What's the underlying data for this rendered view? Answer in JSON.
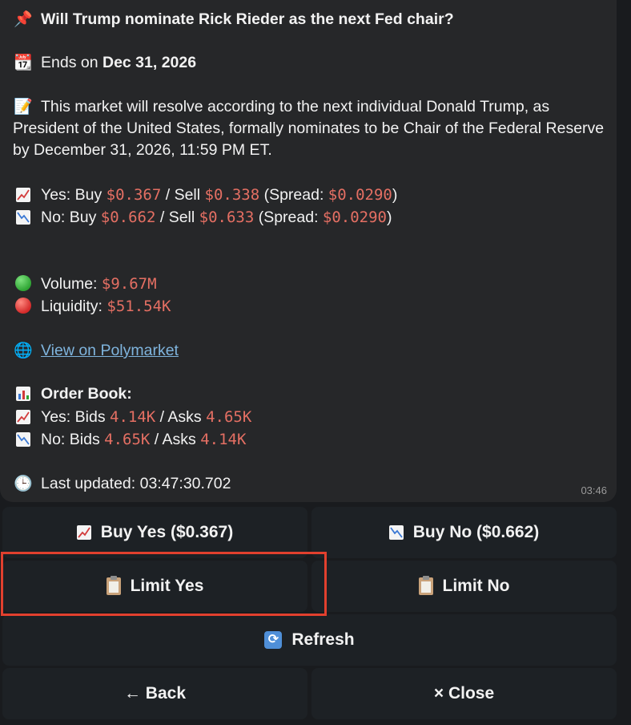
{
  "message": {
    "title": "Will Trump nominate Rick Rieder as the next Fed chair?",
    "ends_label": "Ends on",
    "ends_date": "Dec 31, 2026",
    "description": "This market will resolve according to the next individual Donald Trump, as President of the United States, formally nominates to be Chair of the Federal Reserve by December 31, 2026, 11:59 PM ET.",
    "yes_line": {
      "label": "Yes: Buy",
      "buy": "$0.367",
      "sell_label": "/ Sell",
      "sell": "$0.338",
      "spread_label": "(Spread:",
      "spread": "$0.0290",
      "close": ")"
    },
    "no_line": {
      "label": "No: Buy",
      "buy": "$0.662",
      "sell_label": "/ Sell",
      "sell": "$0.633",
      "spread_label": "(Spread:",
      "spread": "$0.0290",
      "close": ")"
    },
    "volume_label": "Volume:",
    "volume": "$9.67M",
    "liquidity_label": "Liquidity:",
    "liquidity": "$51.54K",
    "link_text": "View on Polymarket",
    "orderbook_title": "Order Book:",
    "ob_yes": {
      "label": "Yes: Bids",
      "bids": "4.14K",
      "asks_label": "/ Asks",
      "asks": "4.65K"
    },
    "ob_no": {
      "label": "No: Bids",
      "bids": "4.65K",
      "asks_label": "/ Asks",
      "asks": "4.14K"
    },
    "updated_label": "Last updated: 03:47:30.702",
    "time": "03:46"
  },
  "buttons": {
    "buy_yes": "Buy Yes ($0.367)",
    "buy_no": "Buy No ($0.662)",
    "limit_yes": "Limit Yes",
    "limit_no": "Limit No",
    "refresh": "Refresh",
    "back": "← Back",
    "close": "× Close"
  },
  "icons": {
    "pin": "pushpin-icon",
    "calendar": "calendar-icon",
    "memo": "memo-icon",
    "up": "chart-increasing-icon",
    "down": "chart-decreasing-icon",
    "globe": "globe-icon",
    "bar": "bar-chart-icon",
    "clock": "clock-icon",
    "clipboard": "clipboard-icon",
    "refresh": "refresh-icon"
  },
  "colors": {
    "price": "#e46f63",
    "link": "#7fb4dd",
    "highlight": "#e2402e"
  }
}
